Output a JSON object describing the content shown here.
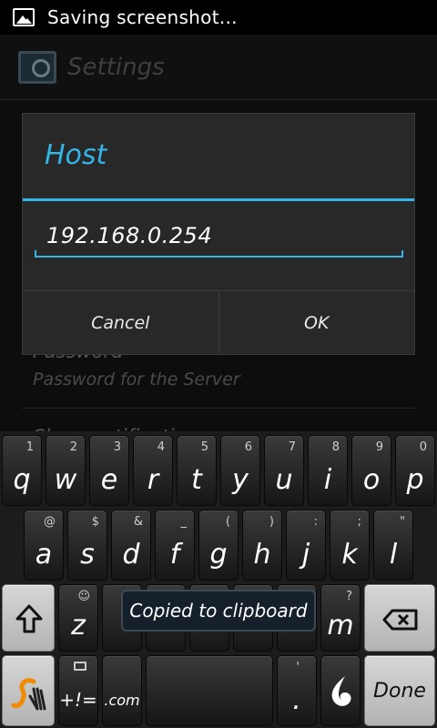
{
  "status_bar": {
    "icon": "picture-icon",
    "text": "Saving screenshot..."
  },
  "settings": {
    "title": "Settings",
    "prefs": [
      {
        "title": "Password",
        "summary": "Password for the Server"
      },
      {
        "title": "Show notification",
        "summary": ""
      }
    ]
  },
  "dialog": {
    "title": "Host",
    "input_value": "192.168.0.254",
    "cancel_label": "Cancel",
    "ok_label": "OK"
  },
  "keyboard": {
    "row1": [
      {
        "main": "q",
        "hint": "1"
      },
      {
        "main": "w",
        "hint": "2"
      },
      {
        "main": "e",
        "hint": "3"
      },
      {
        "main": "r",
        "hint": "4"
      },
      {
        "main": "t",
        "hint": "5"
      },
      {
        "main": "y",
        "hint": "6"
      },
      {
        "main": "u",
        "hint": "7"
      },
      {
        "main": "i",
        "hint": "8"
      },
      {
        "main": "o",
        "hint": "9"
      },
      {
        "main": "p",
        "hint": "0"
      }
    ],
    "row2": [
      {
        "main": "a",
        "hint": "@"
      },
      {
        "main": "s",
        "hint": "$"
      },
      {
        "main": "d",
        "hint": "&"
      },
      {
        "main": "f",
        "hint": "_"
      },
      {
        "main": "g",
        "hint": "("
      },
      {
        "main": "h",
        "hint": ")"
      },
      {
        "main": "j",
        "hint": ":"
      },
      {
        "main": "k",
        "hint": ";"
      },
      {
        "main": "l",
        "hint": "\""
      }
    ],
    "row3": [
      {
        "main": "z",
        "hint": "☺"
      },
      {
        "main": "m",
        "hint": "?"
      }
    ],
    "symbols_label": "+!=",
    "dotcom_label": ".com",
    "period_label": ".",
    "period_hint": "'",
    "done_label": "Done",
    "clipboard_toast": "Copied to clipboard"
  }
}
